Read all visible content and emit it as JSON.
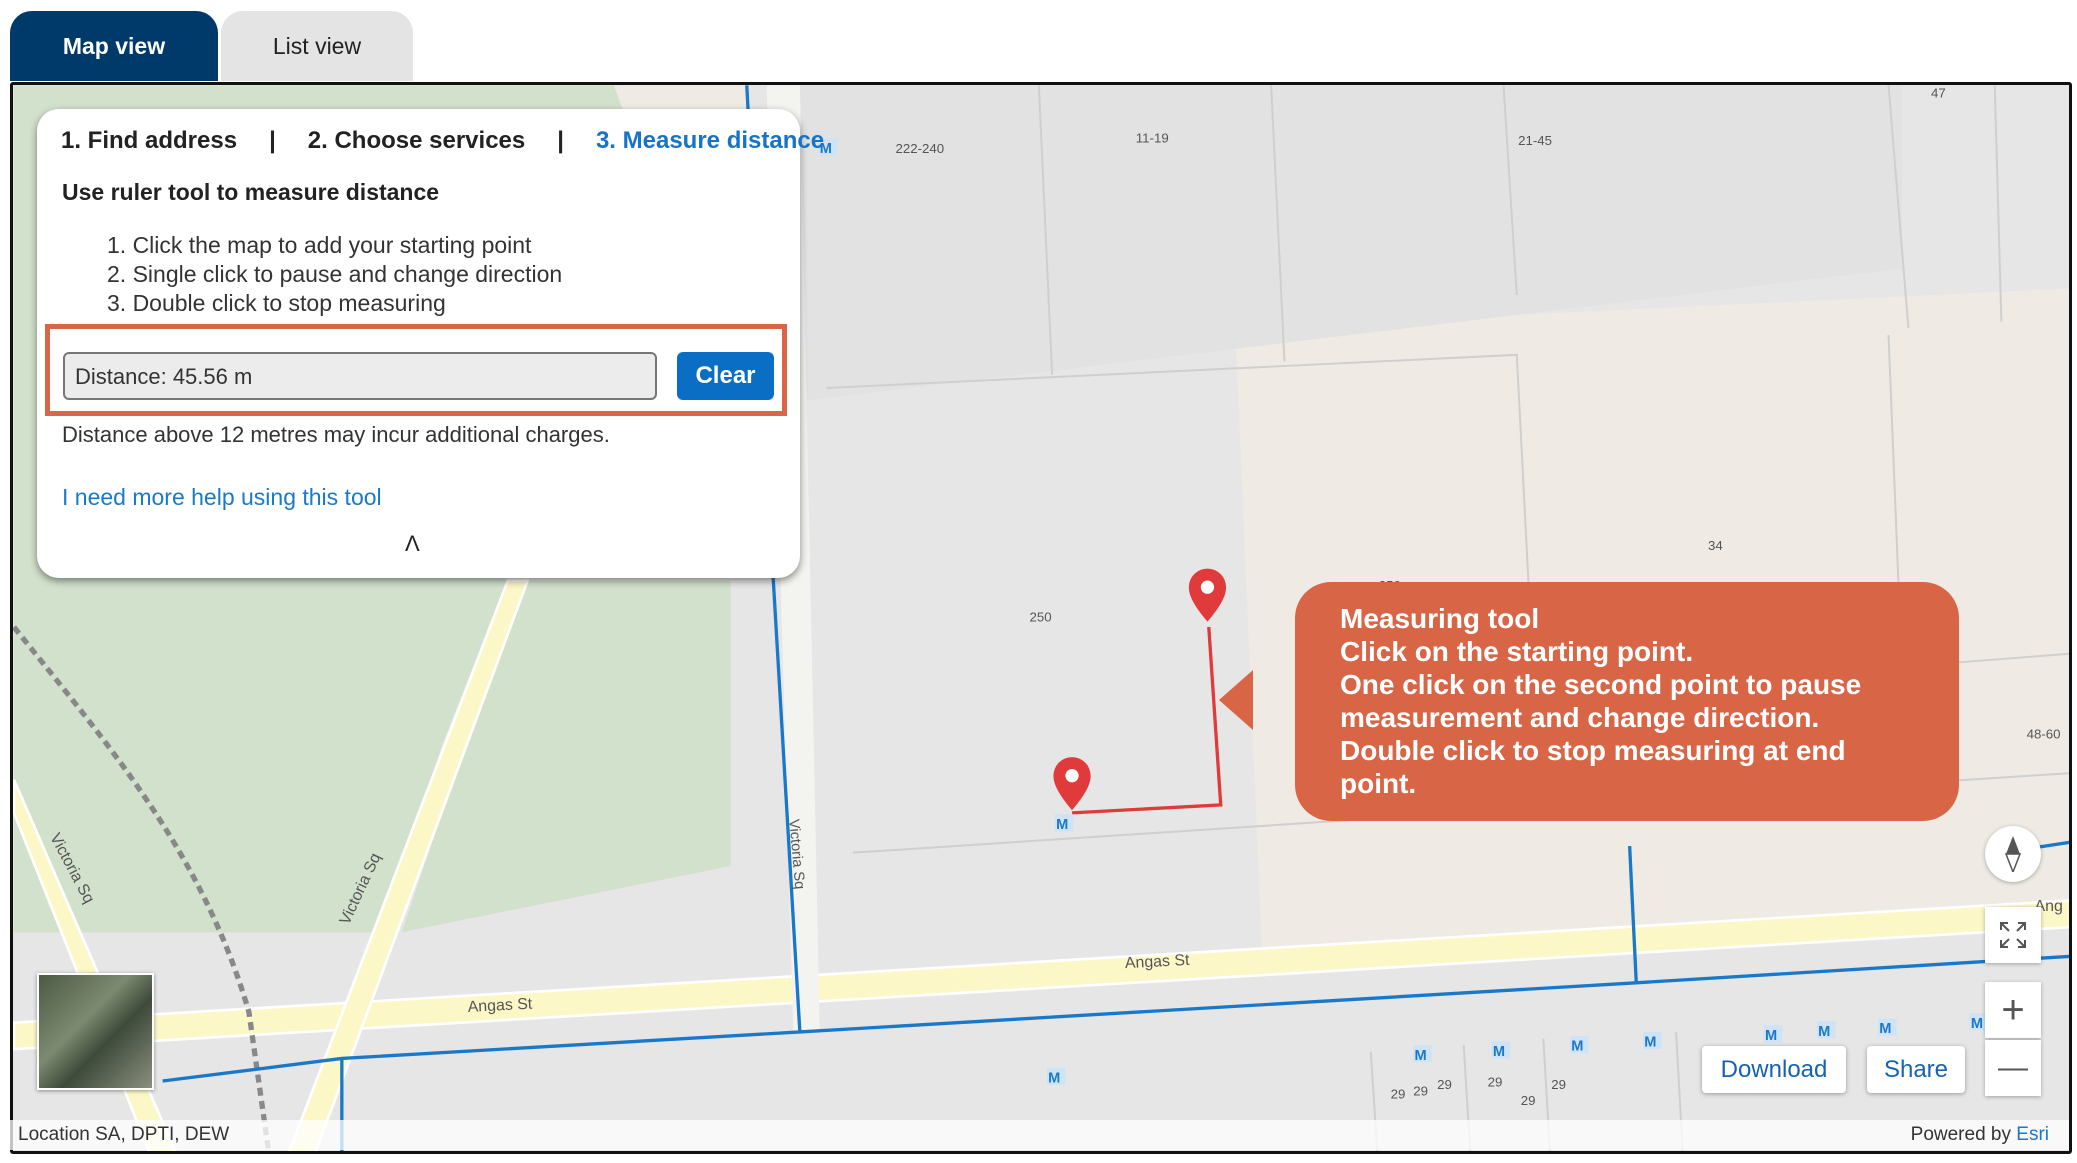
{
  "tabs": [
    {
      "label": "Map view",
      "active": true
    },
    {
      "label": "List view",
      "active": false
    }
  ],
  "panel": {
    "steps": [
      "1. Find address",
      "2. Choose services",
      "3. Measure distance"
    ],
    "separator": "|",
    "active_step": 2,
    "title": "Use ruler tool to measure distance",
    "instructions": [
      "1. Click the map to add your starting point",
      "2. Single click to pause and change direction",
      "3. Double click to stop measuring"
    ],
    "distance_value": "Distance: 45.56 m",
    "clear_label": "Clear",
    "note": "Distance above 12 metres may incur additional charges.",
    "help_link": "I need more help using this tool",
    "collapse_icon": "^"
  },
  "callout": {
    "lines": [
      "Measuring tool",
      "Click on the starting point.",
      "One click on the second point to pause measurement and change direction.",
      "Double click to stop measuring at end point."
    ]
  },
  "map": {
    "parcel_labels": [
      "222-240",
      "11-19",
      "21-45",
      "47",
      "250",
      "34",
      "48-60",
      "29",
      "250"
    ],
    "streets": [
      "Angas St",
      "Angas St",
      "Victoria Sq",
      "Victoria Sq",
      "Victoria Sq",
      "Ang"
    ],
    "meter_marker": "M",
    "colors": {
      "pin": "#e03a3a",
      "measure_line": "#e03a3a",
      "service_line": "#1a78c8",
      "road": "#fbf7c6",
      "park": "#d2e1cc",
      "accent": "#d86646"
    }
  },
  "controls": {
    "download_label": "Download",
    "share_label": "Share",
    "zoom_in": "+",
    "zoom_out": "—"
  },
  "footer": {
    "attribution": "Location SA, DPTI, DEW",
    "powered_by": "Powered by",
    "esri": "Esri"
  }
}
